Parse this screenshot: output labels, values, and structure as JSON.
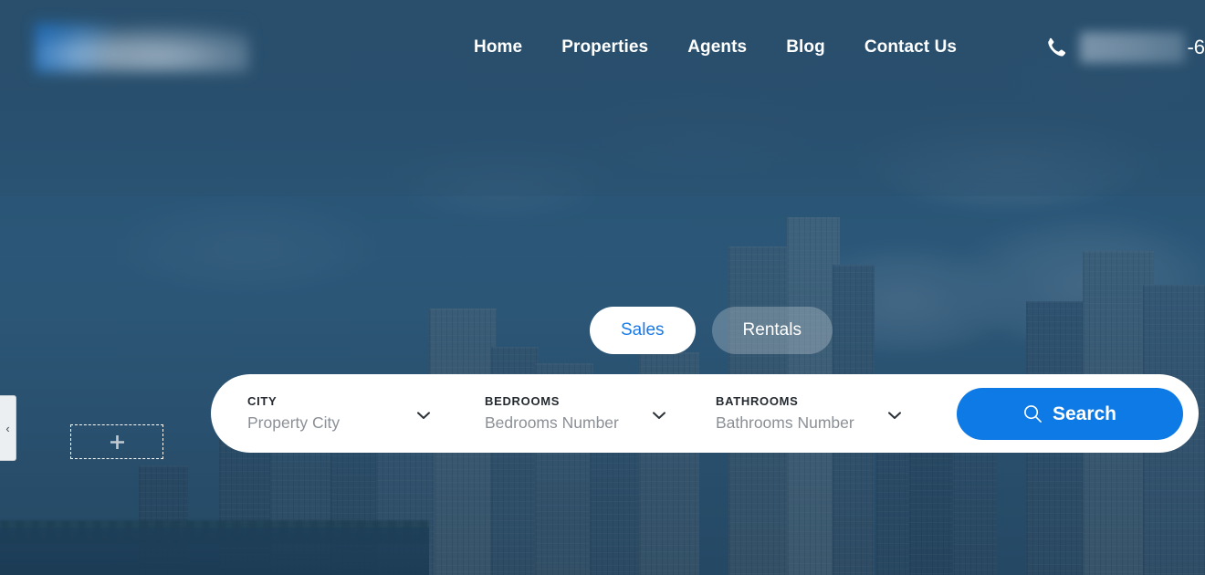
{
  "header": {
    "logo_alt": "site-logo-redacted",
    "nav": [
      {
        "label": "Home"
      },
      {
        "label": "Properties"
      },
      {
        "label": "Agents"
      },
      {
        "label": "Blog"
      },
      {
        "label": "Contact Us"
      }
    ],
    "phone": {
      "icon": "phone-icon",
      "number_redacted": "",
      "number_visible_tail": "-6"
    }
  },
  "hero": {
    "listing_type_toggle": {
      "active": "Sales",
      "options": [
        {
          "label": "Sales",
          "active": true
        },
        {
          "label": "Rentals",
          "active": false
        }
      ]
    },
    "search": {
      "fields": [
        {
          "label": "CITY",
          "placeholder": "Property City",
          "value": ""
        },
        {
          "label": "BEDROOMS",
          "placeholder": "Bedrooms Number",
          "value": ""
        },
        {
          "label": "BATHROOMS",
          "placeholder": "Bathrooms Number",
          "value": ""
        }
      ],
      "submit_label": "Search",
      "submit_icon": "search-icon"
    }
  },
  "builder": {
    "collapse_tab_icon": "chevron-left-icon",
    "add_block_icon": "plus-icon"
  },
  "colors": {
    "accent_blue": "#0d7ae5",
    "toggle_active_text": "#1a7ae8",
    "overlay_blue": "#294f6d",
    "panel_white": "#ffffff",
    "placeholder_gray": "#8b9096"
  }
}
